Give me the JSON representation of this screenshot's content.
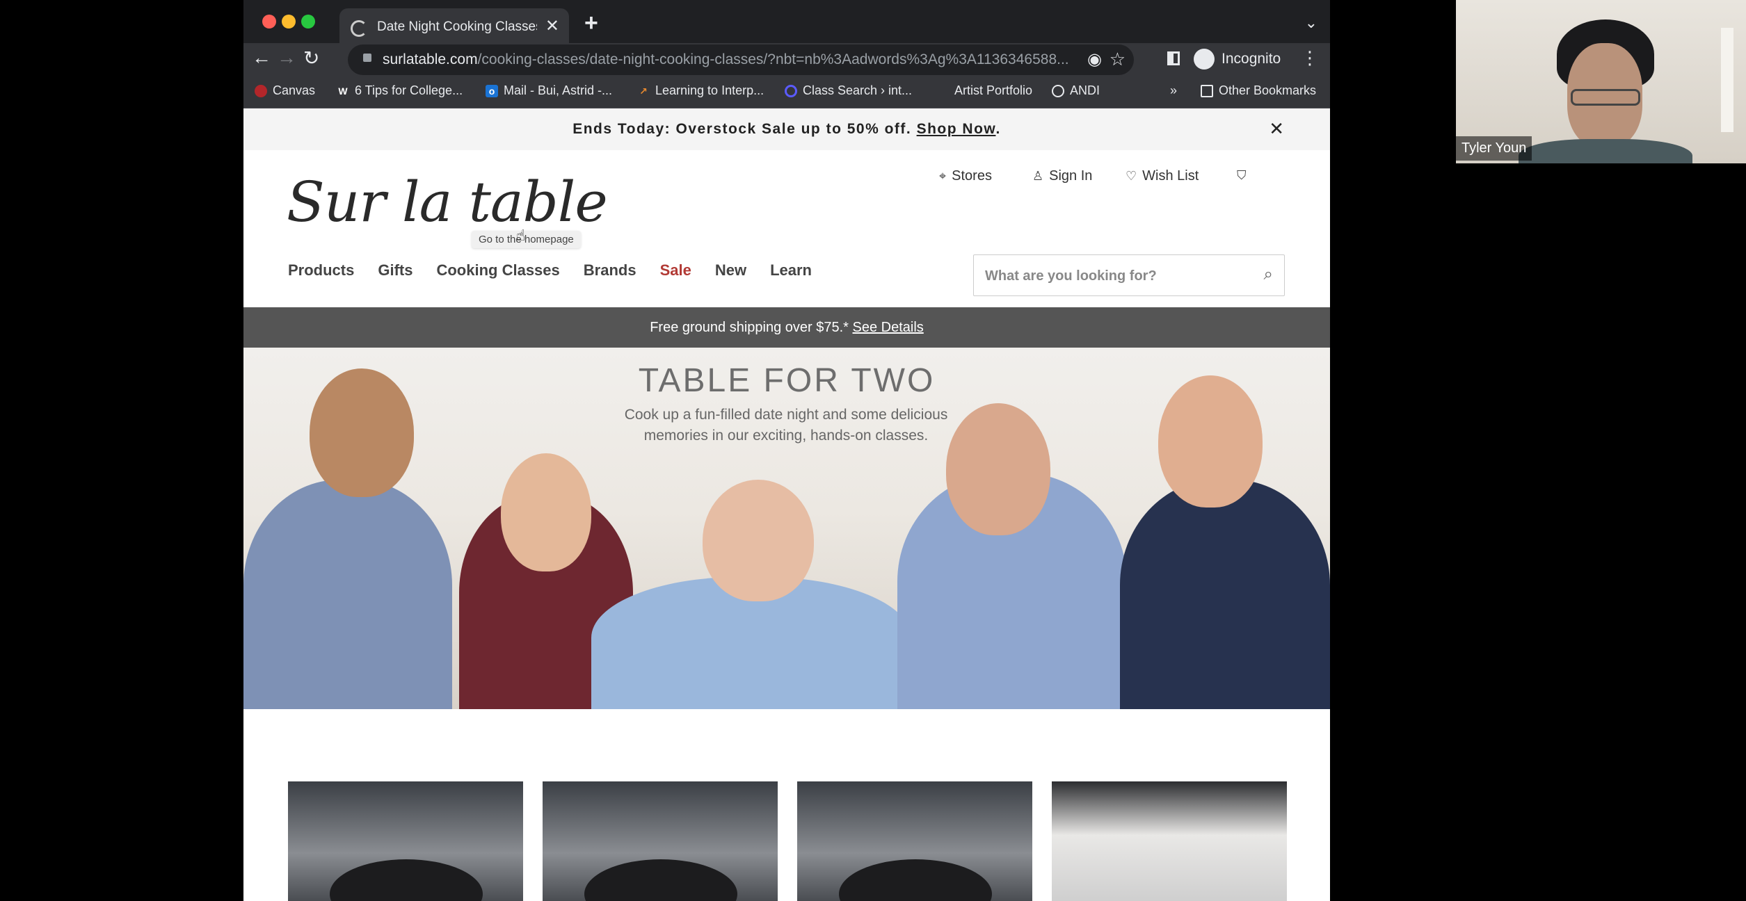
{
  "browser": {
    "tab_title": "Date Night Cooking Classes | S",
    "url_host": "surlatable.com",
    "url_path": "/cooking-classes/date-night-cooking-classes/?nbt=nb%3Aadwords%3Ag%3A1136346588...",
    "incognito_label": "Incognito",
    "bookmarks": [
      "Canvas",
      "6 Tips for College...",
      "Mail - Bui, Astrid -...",
      "Learning to Interp...",
      "Class Search › int...",
      "Artist Portfolio",
      "ANDI",
      "»",
      "Other Bookmarks"
    ]
  },
  "promo": {
    "text": "Ends Today: Overstock Sale up to 50% off. ",
    "link": "Shop Now",
    "end": "."
  },
  "header": {
    "logo": "Sur la table",
    "logo_tooltip": "Go to the homepage",
    "stores": "Stores",
    "sign_in": "Sign In",
    "wish_list": "Wish List",
    "nav": [
      "Products",
      "Gifts",
      "Cooking Classes",
      "Brands",
      "Sale",
      "New",
      "Learn"
    ],
    "search_placeholder": "What are you looking for?"
  },
  "shipping": {
    "text": "Free ground shipping over $75.* ",
    "link": "See Details"
  },
  "hero": {
    "title": "TABLE FOR TWO",
    "subtitle": "Cook up a fun-filled date night and some delicious memories in our exciting, hands-on classes."
  },
  "video_call": {
    "participant_name": "Tyler Youn"
  },
  "colors": {
    "sale_red": "#b23a35",
    "shipping_bar": "#555555",
    "browser_chrome": "#35363a"
  }
}
